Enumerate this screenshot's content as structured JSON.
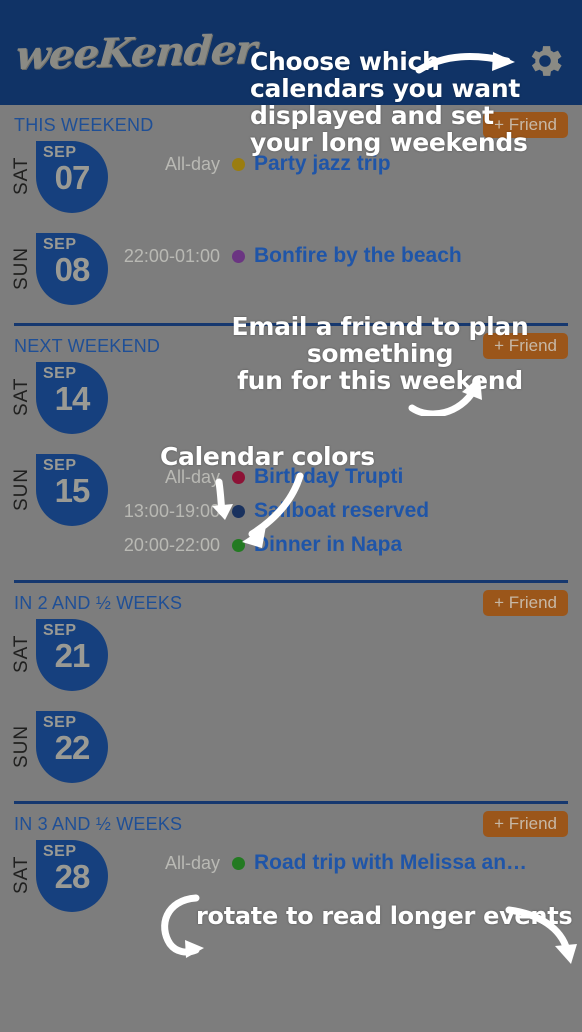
{
  "header": {
    "logo_text": "weeKender",
    "settings_icon": "gear-icon"
  },
  "friend_button_label": "+ Friend",
  "sections": [
    {
      "title": "THIS WEEKEND",
      "show_friend_button": true,
      "days": [
        {
          "dow": "SAT",
          "month": "SEP",
          "day": "07",
          "events": [
            {
              "time": "All-day",
              "dot_color": "#9a7d10",
              "title": "Party jazz trip"
            }
          ]
        },
        {
          "dow": "SUN",
          "month": "SEP",
          "day": "08",
          "events": [
            {
              "time": "22:00-01:00",
              "dot_color": "#6b3582",
              "title": "Bonfire by the beach"
            }
          ]
        }
      ]
    },
    {
      "title": "NEXT WEEKEND",
      "show_friend_button": true,
      "days": [
        {
          "dow": "SAT",
          "month": "SEP",
          "day": "14",
          "events": []
        },
        {
          "dow": "SUN",
          "month": "SEP",
          "day": "15",
          "events": [
            {
              "time": "All-day",
              "dot_color": "#8d1236",
              "title": "Birthday Trupti"
            },
            {
              "time": "13:00-19:00",
              "dot_color": "#19315e",
              "title": "Sailboat reserved"
            },
            {
              "time": "20:00-22:00",
              "dot_color": "#237a22",
              "title": "Dinner in Napa"
            }
          ]
        }
      ]
    },
    {
      "title": "IN 2 AND ½ WEEKS",
      "show_friend_button": true,
      "days": [
        {
          "dow": "SAT",
          "month": "SEP",
          "day": "21",
          "events": []
        },
        {
          "dow": "SUN",
          "month": "SEP",
          "day": "22",
          "events": []
        }
      ]
    },
    {
      "title": "IN 3 AND ½ WEEKS",
      "show_friend_button": true,
      "days": [
        {
          "dow": "SAT",
          "month": "SEP",
          "day": "28",
          "events": [
            {
              "time": "All-day",
              "dot_color": "#237a22",
              "title": "Road trip with Melissa an…"
            }
          ]
        }
      ]
    }
  ],
  "annotations": [
    {
      "id": "settings-hint",
      "text": "Choose which\ncalendars you want\ndisplayed and set\nyour long weekends"
    },
    {
      "id": "friend-hint",
      "text": "Email a friend to plan something\nfun for this weekend"
    },
    {
      "id": "colors-hint",
      "text": "Calendar colors"
    },
    {
      "id": "rotate-hint",
      "text": "rotate to read longer events"
    }
  ],
  "colors": {
    "header_bg": "#103366",
    "page_bg": "#7d7d7d",
    "accent_blue": "#1f55a8",
    "badge_blue": "#16407e",
    "friend_orange": "#9b561a",
    "divider": "#16386f"
  }
}
